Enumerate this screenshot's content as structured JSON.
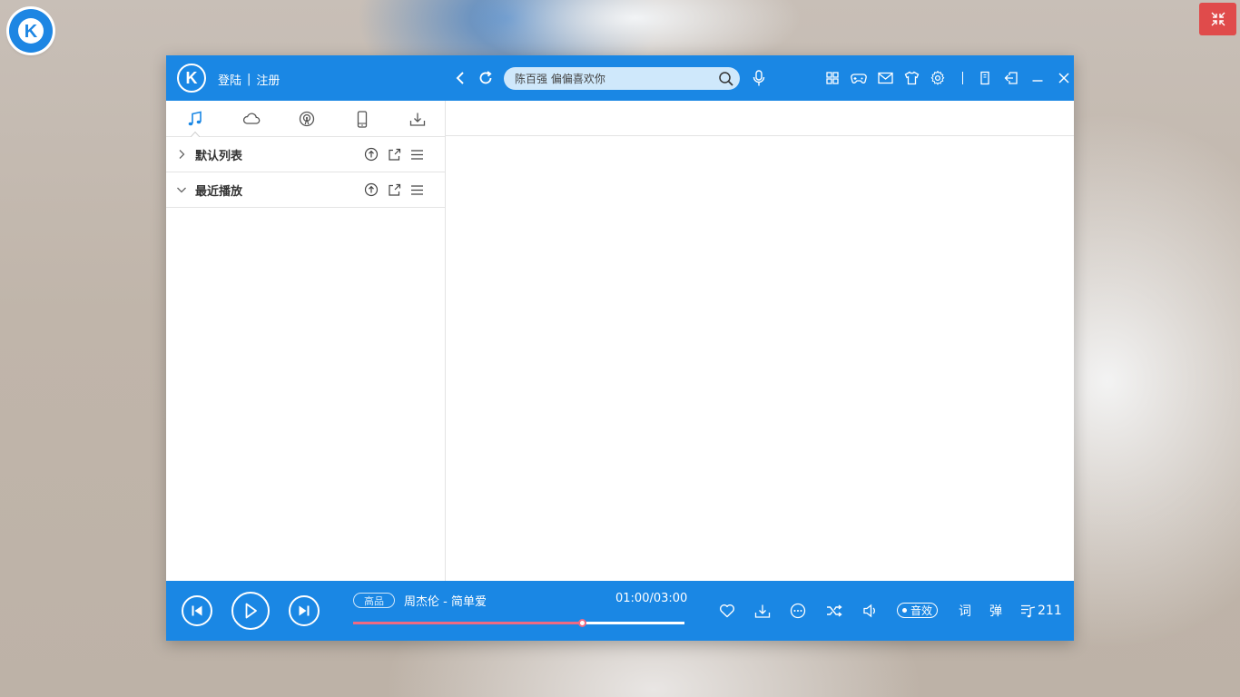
{
  "desktop": {
    "logo_letter": "K",
    "restore_icon": "collapse-arrows-icon"
  },
  "header": {
    "logo_letter": "K",
    "login_label": "登陆",
    "separator": "|",
    "register_label": "注册",
    "search": {
      "placeholder": "陈百强 偏偏喜欢你",
      "value": ""
    },
    "icons": [
      "back-icon",
      "refresh-icon",
      "search-icon",
      "microphone-icon",
      "apps-grid-icon",
      "gamepad-icon",
      "mail-icon",
      "tshirt-skin-icon",
      "settings-gear-icon",
      "mini-mode-icon",
      "exit-window-icon",
      "minimize-icon",
      "close-icon"
    ]
  },
  "sidebar": {
    "tabs": [
      {
        "name": "music-note-icon",
        "active": true
      },
      {
        "name": "cloud-icon",
        "active": false
      },
      {
        "name": "radio-icon",
        "active": false
      },
      {
        "name": "phone-icon",
        "active": false
      },
      {
        "name": "download-icon",
        "active": false
      }
    ],
    "playlists": [
      {
        "name": "默认列表",
        "expanded": false
      },
      {
        "name": "最近播放",
        "expanded": true
      }
    ]
  },
  "player": {
    "quality": "高品",
    "song": "周杰伦 - 简单爱",
    "time": "01:00/03:00",
    "progress": 0.69,
    "sound_effect": "音效",
    "lyrics": "词",
    "danmaku": "弹",
    "queue_count": "211",
    "colors": {
      "bar": "#1a87e4",
      "progress_played": "#ef6a83"
    }
  }
}
